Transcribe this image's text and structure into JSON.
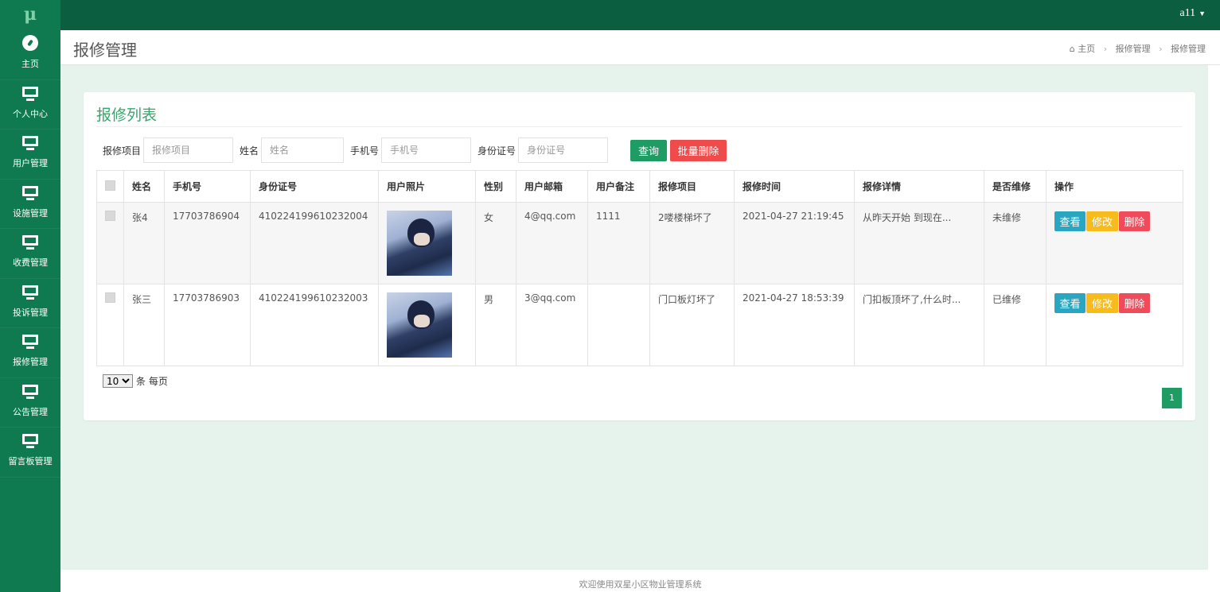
{
  "app": {
    "logo_text": "μ",
    "user_name": "a11"
  },
  "sidebar": {
    "items": [
      {
        "label": "主页",
        "icon": "dashboard-icon"
      },
      {
        "label": "个人中心",
        "icon": "monitor-icon"
      },
      {
        "label": "用户管理",
        "icon": "monitor-icon"
      },
      {
        "label": "设施管理",
        "icon": "monitor-icon"
      },
      {
        "label": "收费管理",
        "icon": "monitor-icon"
      },
      {
        "label": "投诉管理",
        "icon": "monitor-icon"
      },
      {
        "label": "报修管理",
        "icon": "monitor-icon"
      },
      {
        "label": "公告管理",
        "icon": "monitor-icon"
      },
      {
        "label": "留言板管理",
        "icon": "monitor-icon"
      }
    ]
  },
  "header": {
    "title": "报修管理",
    "breadcrumb": [
      "主页",
      "报修管理",
      "报修管理"
    ]
  },
  "panel": {
    "title": "报修列表",
    "filters": [
      {
        "label": "报修项目",
        "placeholder": "报修项目",
        "value": ""
      },
      {
        "label": "姓名",
        "placeholder": "姓名",
        "value": ""
      },
      {
        "label": "手机号",
        "placeholder": "手机号",
        "value": ""
      },
      {
        "label": "身份证号",
        "placeholder": "身份证号",
        "value": ""
      }
    ],
    "search_label": "查询",
    "batch_delete_label": "批量删除"
  },
  "table": {
    "columns": [
      "姓名",
      "手机号",
      "身份证号",
      "用户照片",
      "性别",
      "用户邮箱",
      "用户备注",
      "报修项目",
      "报修时间",
      "报修详情",
      "是否维修",
      "操作"
    ],
    "rows": [
      {
        "name": "张4",
        "phone": "17703786904",
        "id_number": "410224199610232004",
        "gender": "女",
        "email": "4@qq.com",
        "remark": "1111",
        "item": "2喽楼梯坏了",
        "time": "2021-04-27 21:19:45",
        "detail": "从昨天开始 到现在...",
        "status": "未维修"
      },
      {
        "name": "张三",
        "phone": "17703786903",
        "id_number": "410224199610232003",
        "gender": "男",
        "email": "3@qq.com",
        "remark": "",
        "item": "门口板灯坏了",
        "time": "2021-04-27 18:53:39",
        "detail": "门扣板顶坏了,什么时...",
        "status": "已维修"
      }
    ],
    "action_labels": {
      "view": "查看",
      "edit": "修改",
      "delete": "删除"
    }
  },
  "pagination": {
    "page_size": "10",
    "page_size_suffix": "条 每页",
    "current_page": "1"
  },
  "footer": {
    "text": "欢迎使用双星小区物业管理系统"
  },
  "colors": {
    "sidebar": "#0f7a4f",
    "topbar": "#0b5e3f",
    "accent": "#34a86a",
    "primary_button": "#1f9c63",
    "danger_button": "#f04b4b",
    "info_button": "#2aa6c0",
    "warning_button": "#f7bb1b"
  }
}
